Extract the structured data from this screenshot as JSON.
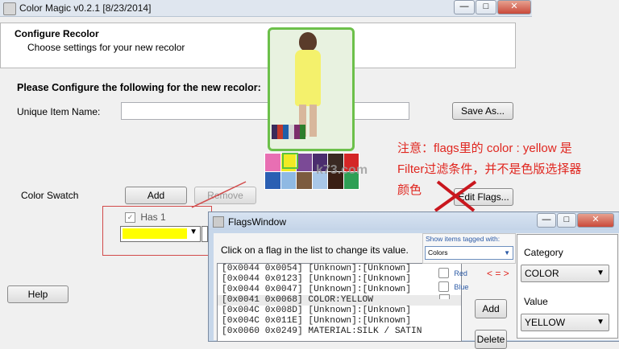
{
  "window": {
    "title": "Color Magic v0.2.1 [8/23/2014]",
    "minimize": "—",
    "maximize": "□",
    "close": "✕"
  },
  "header": {
    "title": "Configure Recolor",
    "subtitle": "Choose settings for your new recolor"
  },
  "form": {
    "section_title": "Please Configure the following for the new recolor:",
    "unique_name_label": "Unique Item Name:",
    "unique_name_value": "",
    "save_as": "Save As...",
    "color_swatch_label": "Color Swatch",
    "add": "Add",
    "remove": "Remove",
    "has_label": "Has 1",
    "edit_flags": "Edit Flags...",
    "help": "Help",
    "swatch_color": "#ffff00"
  },
  "annotation": {
    "line1": "注意：flags里的 color : yellow 是",
    "line2": "Filter过滤条件，并不是色版选择器",
    "line3": "颜色",
    "watermark": "k73.com",
    "arrows": "< = >"
  },
  "preview": {
    "strip_colors": [
      "#3a2b5a",
      "#c0392b",
      "#1f5fa8",
      "#d5d5d5",
      "#7b2d6b",
      "#2c7f2c"
    ],
    "palette_colors": [
      "#e86fb3",
      "#f2ea24",
      "#7b4a96",
      "#4b2d6e",
      "#3a2a23",
      "#d42626",
      "#2b5fb3",
      "#8fb9e3",
      "#7c5b3f",
      "#a9c7e8",
      "#3a1f14",
      "#2e9f55"
    ]
  },
  "flags_window": {
    "title": "FlagsWindow",
    "instruction": "Click on a flag in the list to change its value.",
    "show_items_label": "Show items tagged with:",
    "show_items_value": "Colors",
    "rows": [
      "[0x0044 0x0054] [Unknown]:[Unknown]",
      "[0x0044 0x0123] [Unknown]:[Unknown]",
      "[0x0044 0x0047] [Unknown]:[Unknown]",
      "[0x0041 0x0068] COLOR:YELLOW",
      "[0x004C 0x008D] [Unknown]:[Unknown]",
      "[0x004C 0x011E] [Unknown]:[Unknown]",
      "[0x0060 0x0249] MATERIAL:SILK / SATIN"
    ],
    "tag_red": "Red",
    "tag_blue": "Blue",
    "add": "Add",
    "delete": "Delete",
    "category_label": "Category",
    "category_value": "COLOR",
    "value_label": "Value",
    "value_value": "YELLOW"
  }
}
